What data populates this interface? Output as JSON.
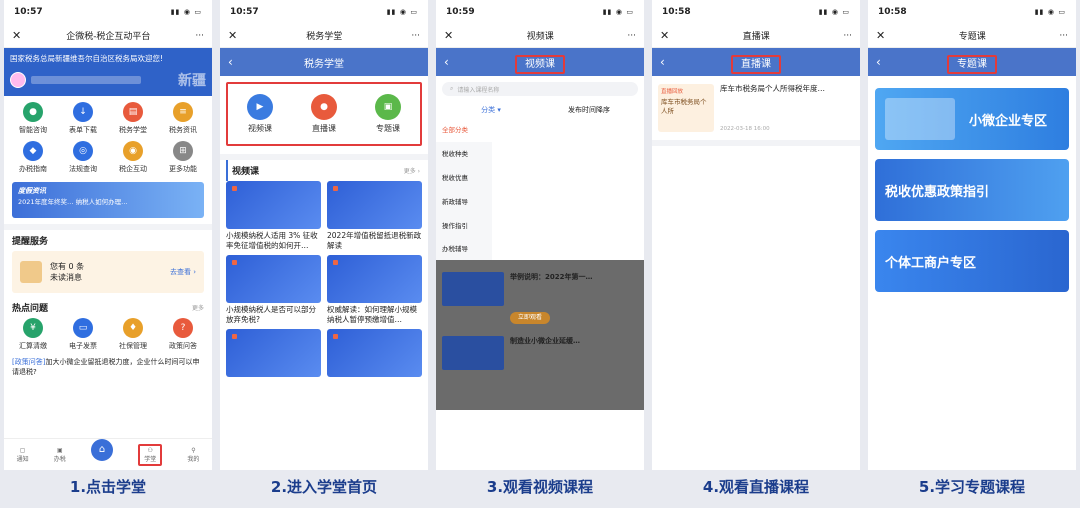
{
  "status_times": [
    "10:57",
    "10:57",
    "10:59",
    "10:58",
    "10:58"
  ],
  "status_icons": "▮▮ ◉ ▭",
  "more_icon": "···",
  "close_icon": "✕",
  "back_icon": "‹",
  "p1": {
    "title": "企微税-税企互动平台",
    "welcome": "国家税务总局新疆维吾尔自治区税务局欢迎您!",
    "brand_text": "新疆",
    "grid": [
      "智能咨询",
      "表单下载",
      "税务学堂",
      "税务资讯",
      "办税指南",
      "法规查询",
      "税企互动",
      "更多功能"
    ],
    "banner_title": "度假资讯",
    "banner_text": "2021年度年终奖… 纳税人如何办理…",
    "reminder_header": "提醒服务",
    "reminder_line1": "您有 0 条",
    "reminder_line2": "未读消息",
    "reminder_link": "去查看 ›",
    "hot_header": "热点问题",
    "hot_more": "更多",
    "hot_grid": [
      "汇算清缴",
      "电子发票",
      "社保管理",
      "政策问答"
    ],
    "news_tag": "[政策问答]",
    "news_text": "加大小微企业留抵退税力度，企业什么时间可以申请退税?",
    "tabs": [
      "通知",
      "办税",
      "",
      "学堂",
      "我的"
    ]
  },
  "p2": {
    "title": "税务学堂",
    "cats": [
      "视频课",
      "直播课",
      "专题课"
    ],
    "sec_title": "视频课",
    "sec_more": "更多 ›",
    "videos": [
      "小规模纳税人适用 3% 征收率免征增值税的如何开…",
      "2022年增值税留抵退税新政解读",
      "小规模纳税人是否可以部分放弃免税?",
      "权威解读：如何理解小规模纳税人暂停预缴增值…",
      "",
      ""
    ]
  },
  "p3": {
    "title": "视频课",
    "search": "请输入课程名称",
    "filter1": "分类 ▾",
    "filter2": "发布时间降序",
    "cats": [
      "全部分类",
      "税收种类",
      "税收优惠",
      "新政辅导",
      "操作指引",
      "办税辅导"
    ],
    "items": [
      "举例说明：2022年第一…",
      "制造业小微企业延缓…"
    ],
    "item_btn": "立即观看"
  },
  "p4": {
    "title": "直播课",
    "live_tag": "直播回放",
    "thumb_text": "库车市税务局个人所",
    "live_title": "库车市税务局个人所得税年度…",
    "live_date": "2022-03-18 16:00"
  },
  "p5": {
    "title": "专题课",
    "banners": [
      "小微企业专区",
      "税收优惠政策指引",
      "个体工商户专区"
    ]
  },
  "captions": [
    "1.点击学堂",
    "2.进入学堂首页",
    "3.观看视频课程",
    "4.观看直播课程",
    "5.学习专题课程"
  ]
}
